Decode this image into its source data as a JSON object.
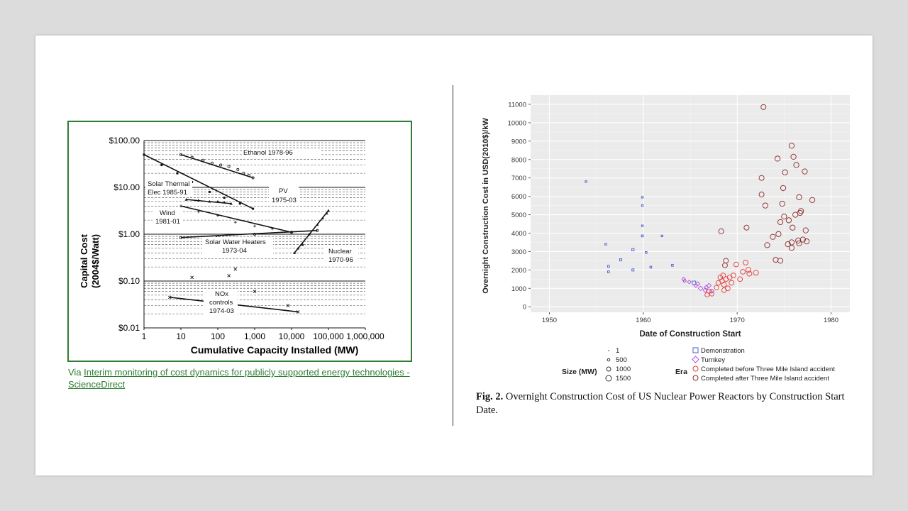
{
  "left_chart": {
    "ylabel_line1": "Capital Cost",
    "ylabel_line2": "(2004$/Watt)",
    "xlabel": "Cumulative Capacity Installed (MW)",
    "yticks": [
      "$100.00",
      "$10.00",
      "$1.00",
      "$0.10",
      "$0.01"
    ],
    "xticks": [
      "1",
      "10",
      "100",
      "1,000",
      "10,000",
      "100,000",
      "1,000,000"
    ],
    "labels": {
      "ethanol": "Ethanol 1978-96",
      "solar_thermal_1": "Solar Thermal",
      "solar_thermal_2": "Elec 1985-91",
      "pv_1": "PV",
      "pv_2": "1975-03",
      "wind_1": "Wind",
      "wind_2": "1981-01",
      "swh_1": "Solar Water Heaters",
      "swh_2": "1973-04",
      "nuclear_1": "Nuclear",
      "nuclear_2": "1970-96",
      "nox_1": "NOx",
      "nox_2": "controls",
      "nox_3": "1974-03"
    }
  },
  "source": {
    "prefix": "Via ",
    "link_text": "Interim monitoring of cost dynamics for publicly supported energy technologies - ScienceDirect"
  },
  "right_chart": {
    "ylabel": "Overnight Construction Cost in USD(2010$)/kW",
    "xlabel": "Date of Construction Start",
    "yticks": [
      "0",
      "1000",
      "2000",
      "3000",
      "4000",
      "5000",
      "6000",
      "7000",
      "8000",
      "9000",
      "10000",
      "11000"
    ],
    "xticks": [
      "1950",
      "1960",
      "1970",
      "1980"
    ],
    "legend": {
      "size_title": "Size (MW)",
      "sizes": [
        "1",
        "500",
        "1000",
        "1500"
      ],
      "era_title": "Era",
      "eras": [
        "Demonstration",
        "Turnkey",
        "Completed before Three Mile Island accident",
        "Completed after Three Mile Island accident"
      ]
    },
    "colors": {
      "demonstration": "#4a5fd0",
      "turnkey": "#b44fe0",
      "before_tmi": "#e33b3b",
      "after_tmi": "#8b2a2a",
      "panel_bg": "#ebebeb"
    }
  },
  "caption": {
    "label": "Fig. 2.",
    "text": " Overnight Construction Cost of US Nuclear Power Reactors by Construction Start Date."
  },
  "chart_data": [
    {
      "type": "scatter",
      "ylabel": "Capital Cost (2004$/Watt)",
      "xlabel": "Cumulative Capacity Installed (MW)",
      "xscale": "log",
      "yscale": "log",
      "xlim": [
        1,
        1000000
      ],
      "ylim": [
        0.01,
        100
      ],
      "series": [
        {
          "name": "Ethanol 1978-96",
          "x": [
            10,
            20,
            40,
            70,
            120,
            200,
            350,
            500,
            700,
            900
          ],
          "y": [
            50,
            44,
            38,
            33,
            30,
            28,
            24,
            20,
            18,
            16
          ]
        },
        {
          "name": "Solar Thermal Elec 1985-91",
          "x": [
            14,
            30,
            60,
            100,
            150,
            230
          ],
          "y": [
            5.5,
            5.3,
            5.0,
            5.0,
            4.8,
            4.5
          ]
        },
        {
          "name": "PV 1975-03",
          "x": [
            1,
            3,
            8,
            20,
            60,
            150,
            400,
            900
          ],
          "y": [
            50,
            30,
            20,
            13,
            8,
            6,
            4.5,
            3.5
          ]
        },
        {
          "name": "Wind 1981-01",
          "x": [
            10,
            30,
            100,
            300,
            1000,
            3000,
            10000
          ],
          "y": [
            4.0,
            3.0,
            2.5,
            1.8,
            1.5,
            1.3,
            1.1
          ]
        },
        {
          "name": "Solar Water Heaters 1973-04",
          "x": [
            10,
            100,
            1000,
            10000,
            50000
          ],
          "y": [
            0.85,
            0.9,
            1.0,
            1.1,
            1.2
          ]
        },
        {
          "name": "Nuclear 1970-96",
          "x": [
            12000,
            15000,
            20000,
            30000,
            50000,
            70000,
            90000,
            100000
          ],
          "y": [
            0.4,
            0.5,
            0.6,
            1.0,
            1.6,
            2.2,
            2.8,
            3.2
          ]
        },
        {
          "name": "NOx controls 1974-03",
          "x": [
            5,
            20,
            200,
            300,
            1000,
            8000,
            15000
          ],
          "y": [
            0.045,
            0.12,
            0.13,
            0.18,
            0.06,
            0.03,
            0.022
          ]
        }
      ]
    },
    {
      "type": "scatter",
      "ylabel": "Overnight Construction Cost in USD(2010$)/kW",
      "xlabel": "Date of Construction Start",
      "xlim": [
        1948,
        1982
      ],
      "ylim": [
        -300,
        11500
      ],
      "series": [
        {
          "name": "Demonstration",
          "points": [
            [
              1953.9,
              6800,
              20
            ],
            [
              1956.0,
              3400,
              20
            ],
            [
              1956.3,
              2200,
              40
            ],
            [
              1956.3,
              1900,
              40
            ],
            [
              1957.6,
              2550,
              80
            ],
            [
              1958.9,
              3100,
              100
            ],
            [
              1958.9,
              2000,
              80
            ],
            [
              1959.9,
              5950,
              20
            ],
            [
              1959.9,
              5500,
              20
            ],
            [
              1959.9,
              4400,
              20
            ],
            [
              1959.9,
              3850,
              40
            ],
            [
              1960.3,
              2950,
              40
            ],
            [
              1960.8,
              2150,
              40
            ],
            [
              1962.0,
              3850,
              20
            ],
            [
              1963.1,
              2250,
              40
            ],
            [
              1965.4,
              1300,
              400
            ]
          ]
        },
        {
          "name": "Turnkey",
          "points": [
            [
              1964.3,
              1500,
              500
            ],
            [
              1964.4,
              1400,
              400
            ],
            [
              1964.9,
              1350,
              500
            ],
            [
              1965.6,
              1150,
              600
            ],
            [
              1965.8,
              1250,
              600
            ],
            [
              1966.1,
              1000,
              800
            ],
            [
              1966.6,
              900,
              800
            ],
            [
              1966.7,
              1050,
              700
            ],
            [
              1967.0,
              1150,
              800
            ],
            [
              1967.3,
              850,
              800
            ]
          ]
        },
        {
          "name": "Completed before Three Mile Island accident",
          "points": [
            [
              1966.8,
              650,
              800
            ],
            [
              1967.0,
              850,
              800
            ],
            [
              1967.3,
              700,
              800
            ],
            [
              1967.8,
              1050,
              800
            ],
            [
              1968.0,
              1300,
              900
            ],
            [
              1968.2,
              1600,
              900
            ],
            [
              1968.4,
              1400,
              900
            ],
            [
              1968.5,
              1700,
              1000
            ],
            [
              1968.6,
              1200,
              900
            ],
            [
              1968.6,
              900,
              900
            ],
            [
              1968.8,
              1500,
              1000
            ],
            [
              1969.0,
              1000,
              1000
            ],
            [
              1969.2,
              1600,
              1000
            ],
            [
              1969.4,
              1300,
              1000
            ],
            [
              1969.6,
              1700,
              1000
            ],
            [
              1969.9,
              2300,
              1000
            ],
            [
              1970.3,
              1500,
              1000
            ],
            [
              1970.6,
              1900,
              1000
            ],
            [
              1970.9,
              2400,
              1000
            ],
            [
              1971.2,
              2000,
              1100
            ],
            [
              1971.3,
              1800,
              1100
            ],
            [
              1972.0,
              1850,
              1100
            ]
          ]
        },
        {
          "name": "Completed after Three Mile Island accident",
          "points": [
            [
              1968.3,
              4100,
              1100
            ],
            [
              1968.7,
              2250,
              1000
            ],
            [
              1968.8,
              2500,
              1000
            ],
            [
              1971.0,
              4300,
              1100
            ],
            [
              1972.6,
              7000,
              1100
            ],
            [
              1972.6,
              6100,
              1100
            ],
            [
              1972.8,
              10850,
              1100
            ],
            [
              1973.0,
              5500,
              1200
            ],
            [
              1973.2,
              3350,
              1200
            ],
            [
              1973.8,
              3800,
              1200
            ],
            [
              1974.1,
              2550,
              1100
            ],
            [
              1974.3,
              8050,
              1200
            ],
            [
              1974.4,
              3950,
              1200
            ],
            [
              1974.6,
              4600,
              1200
            ],
            [
              1974.6,
              2500,
              1200
            ],
            [
              1974.8,
              5600,
              1200
            ],
            [
              1974.9,
              6450,
              1200
            ],
            [
              1975.0,
              4900,
              1200
            ],
            [
              1975.1,
              7300,
              1200
            ],
            [
              1975.4,
              3400,
              1200
            ],
            [
              1975.5,
              4700,
              1200
            ],
            [
              1975.8,
              8750,
              1200
            ],
            [
              1975.8,
              3500,
              1200
            ],
            [
              1975.8,
              3200,
              1200
            ],
            [
              1975.9,
              4300,
              1200
            ],
            [
              1976.0,
              8150,
              1200
            ],
            [
              1976.2,
              5000,
              1200
            ],
            [
              1976.3,
              7700,
              1200
            ],
            [
              1976.5,
              3600,
              1200
            ],
            [
              1976.6,
              3450,
              1200
            ],
            [
              1976.6,
              5950,
              1200
            ],
            [
              1976.7,
              5100,
              1200
            ],
            [
              1976.8,
              5200,
              1200
            ],
            [
              1977.0,
              3650,
              1200
            ],
            [
              1977.2,
              7350,
              1200
            ],
            [
              1977.3,
              4150,
              1200
            ],
            [
              1977.4,
              3550,
              1200
            ],
            [
              1978.0,
              5800,
              1200
            ]
          ]
        }
      ]
    }
  ]
}
